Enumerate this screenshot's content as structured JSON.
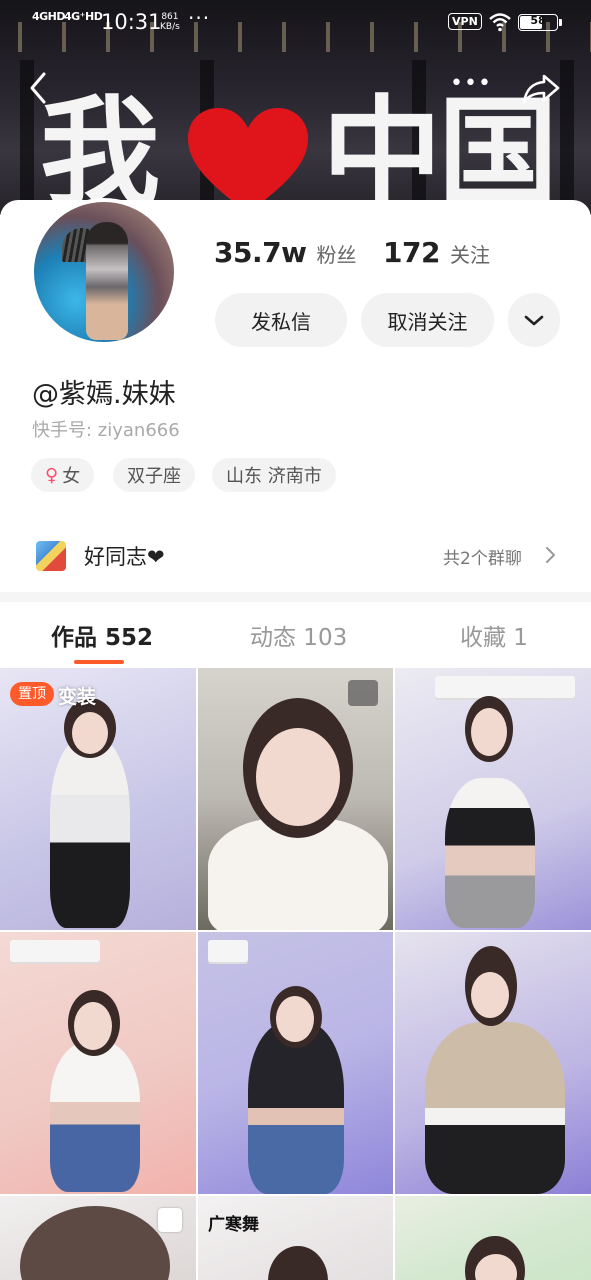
{
  "status_bar": {
    "signal_1": "4GHD",
    "signal_2": "4G⁺HD",
    "time": "10:31",
    "speed_value": "861",
    "speed_unit": "KB/s",
    "vpn": "VPN",
    "battery": "58"
  },
  "cover": {
    "sign_left": "我",
    "sign_right_1": "中",
    "sign_right_2": "国",
    "heart_color": "#e0141b"
  },
  "profile": {
    "followers_value": "35.7w",
    "followers_label": "粉丝",
    "following_value": "172",
    "following_label": "关注",
    "message_button": "发私信",
    "unfollow_button": "取消关注",
    "username": "@紫嫣.妹妹",
    "kuaishou_id": "快手号: ziyan666",
    "tags": {
      "gender_symbol": "♀",
      "gender": "女",
      "zodiac": "双子座",
      "location": "山东 济南市"
    }
  },
  "group": {
    "name": "好同志❤",
    "count": "共2个群聊"
  },
  "tabs": {
    "works": "作品 552",
    "moments": "动态 103",
    "favorites": "收藏 1",
    "active_color": "#ff5a2a"
  },
  "grid": {
    "pinned": "置顶",
    "caption_1": "变装",
    "caption_8": "广寒舞"
  }
}
